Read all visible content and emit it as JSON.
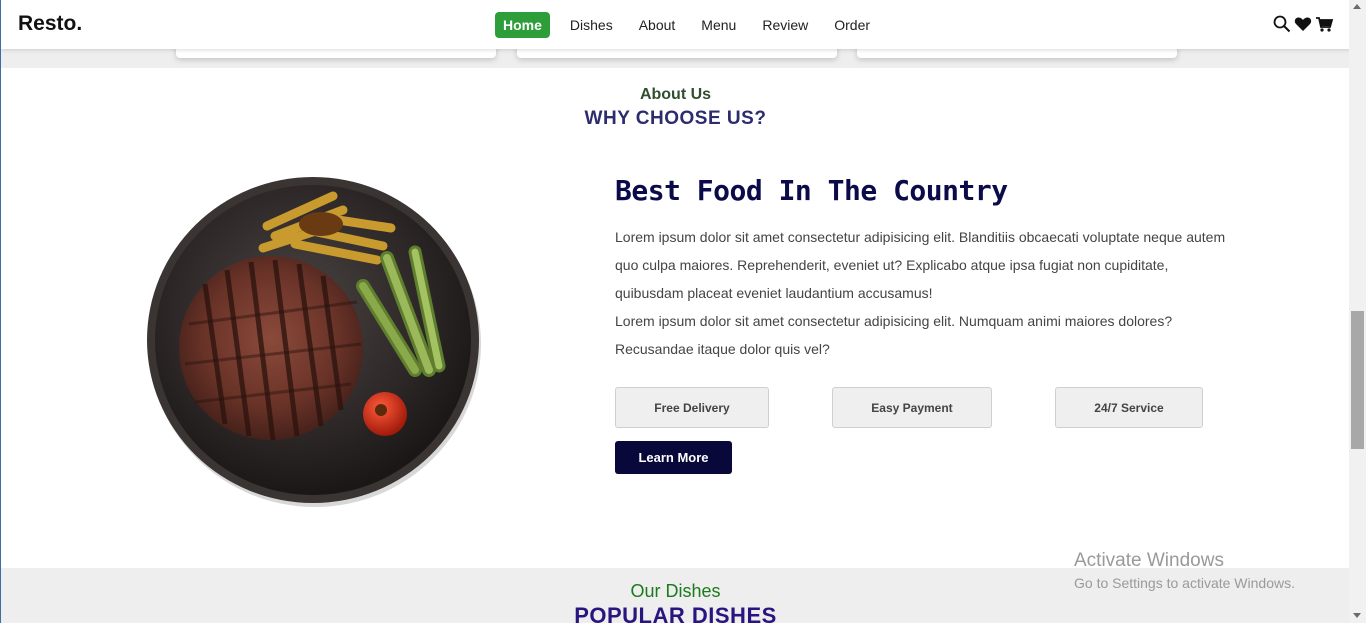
{
  "header": {
    "logo": "Resto.",
    "nav": [
      {
        "label": "Home",
        "active": true
      },
      {
        "label": "Dishes",
        "active": false
      },
      {
        "label": "About",
        "active": false
      },
      {
        "label": "Menu",
        "active": false
      },
      {
        "label": "Review",
        "active": false
      },
      {
        "label": "Order",
        "active": false
      }
    ],
    "icons": [
      "search-icon",
      "heart-icon",
      "cart-icon"
    ]
  },
  "about": {
    "subheading": "About Us",
    "heading": "WHY CHOOSE US?",
    "title": "Best Food In The Country",
    "paragraph1": "Lorem ipsum dolor sit amet consectetur adipisicing elit. Blanditiis obcaecati voluptate neque autem quo culpa maiores. Reprehenderit, eveniet ut? Explicabo atque ipsa fugiat non cupiditate, quibusdam placeat eveniet laudantium accusamus!",
    "paragraph2": "Lorem ipsum dolor sit amet consectetur adipisicing elit. Numquam animi maiores dolores? Recusandae itaque dolor quis vel?",
    "features": [
      "Free Delivery",
      "Easy Payment",
      "24/7 Service"
    ],
    "cta": "Learn More"
  },
  "dishes": {
    "subheading": "Our Dishes",
    "heading": "POPULAR DISHES"
  },
  "watermark": {
    "line1": "Activate Windows",
    "line2": "Go to Settings to activate Windows."
  },
  "colors": {
    "accent": "#2e9e3b",
    "heading_navy": "#0b0b4a",
    "button_dark": "#08083a",
    "section_grey": "#eeeeee"
  }
}
